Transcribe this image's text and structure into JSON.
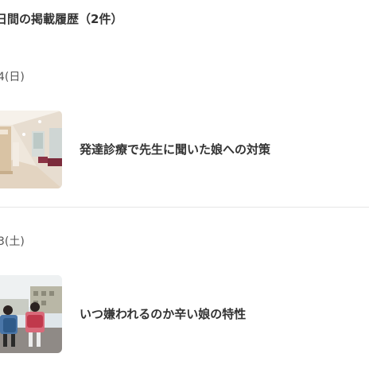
{
  "history": {
    "heading": "日間の掲載履歴（2件）",
    "entries": [
      {
        "date": "4(日)",
        "title": "発達診療で先生に聞いた娘への対策",
        "thumbnail_icon": "hospital-corridor-photo"
      },
      {
        "date": "3(土)",
        "title": "いつ嫌われるのか辛い娘の特性",
        "thumbnail_icon": "schoolchildren-randoseru-photo"
      }
    ]
  }
}
